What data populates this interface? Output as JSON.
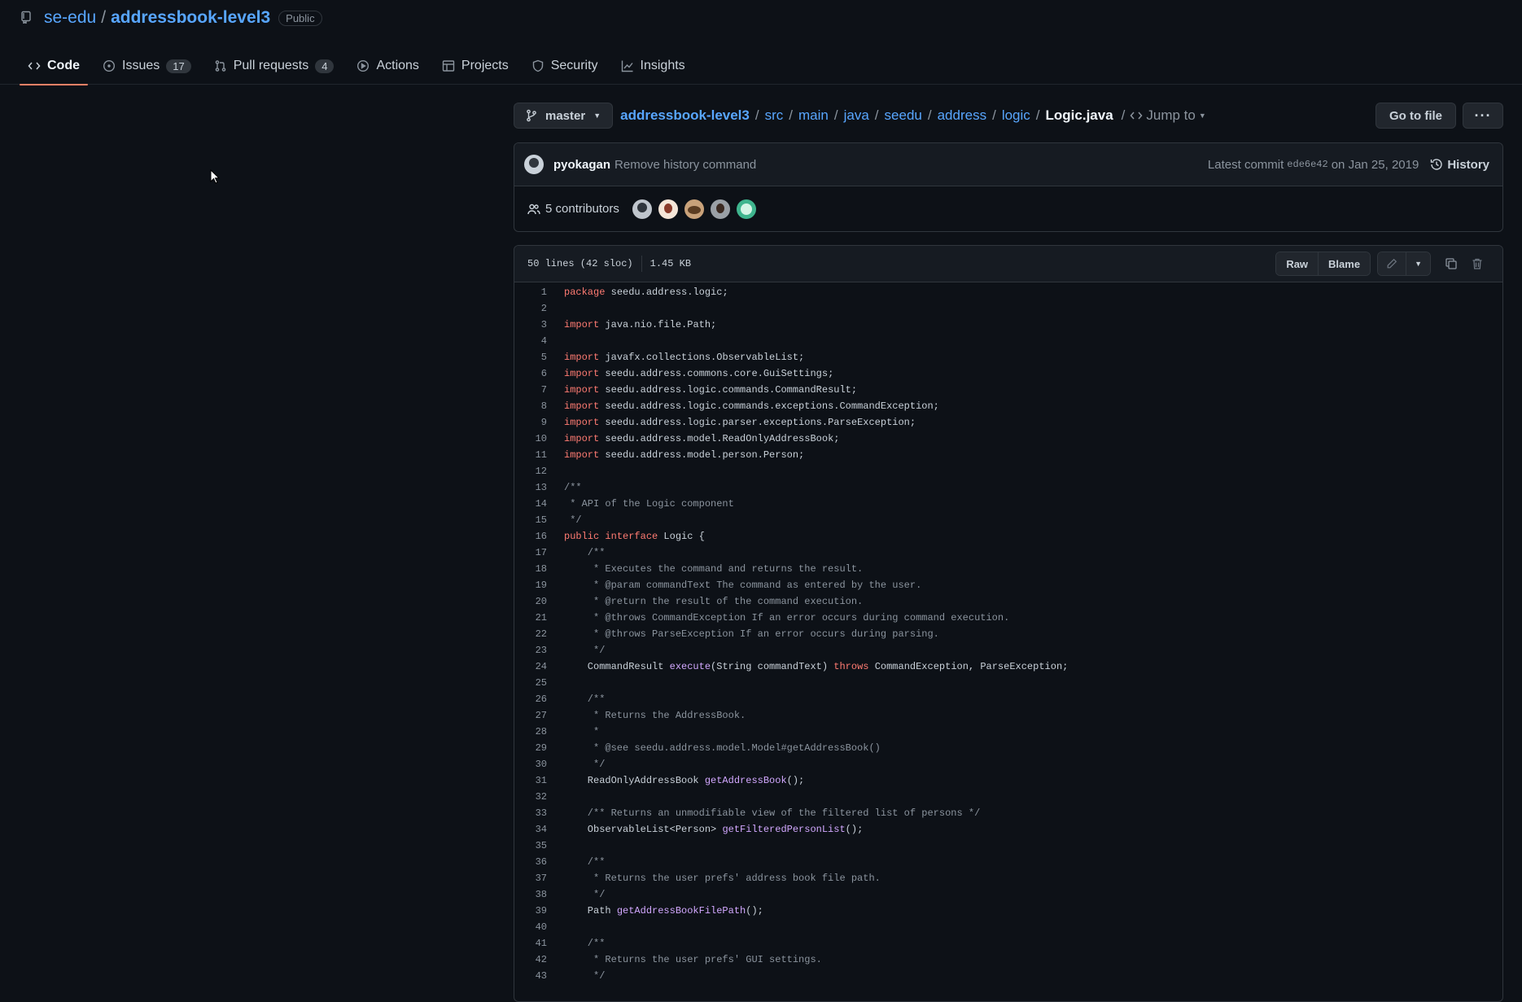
{
  "repo": {
    "owner": "se-edu",
    "separator": "/",
    "name": "addressbook-level3",
    "visibility": "Public"
  },
  "tabs": [
    {
      "label": "Code",
      "icon": "code-icon",
      "active": true
    },
    {
      "label": "Issues",
      "icon": "issue-icon",
      "count": "17"
    },
    {
      "label": "Pull requests",
      "icon": "pull-request-icon",
      "count": "4"
    },
    {
      "label": "Actions",
      "icon": "play-icon"
    },
    {
      "label": "Projects",
      "icon": "table-icon"
    },
    {
      "label": "Security",
      "icon": "shield-icon"
    },
    {
      "label": "Insights",
      "icon": "graph-icon"
    }
  ],
  "branch": {
    "name": "master"
  },
  "breadcrumbs": [
    "addressbook-level3",
    "src",
    "main",
    "java",
    "seedu",
    "address",
    "logic"
  ],
  "breadcrumb_sep": "/",
  "file_name": "Logic.java",
  "jump_to": "Jump to",
  "go_to_file": "Go to file",
  "more_label": "···",
  "commit": {
    "author": "pyokagan",
    "message": "Remove history command",
    "latest_label": "Latest commit",
    "sha": "ede6e42",
    "date": "on Jan 25, 2019",
    "history_label": "History"
  },
  "contributors": {
    "label": "5 contributors"
  },
  "file_stats": {
    "lines": "50 lines (42 sloc)",
    "size": "1.45 KB"
  },
  "file_buttons": {
    "raw": "Raw",
    "blame": "Blame"
  },
  "code_lines": [
    {
      "n": "1",
      "parts": [
        {
          "t": "kw",
          "s": "package"
        },
        {
          "t": "",
          "s": " seedu.address.logic;"
        }
      ]
    },
    {
      "n": "2",
      "parts": []
    },
    {
      "n": "3",
      "parts": [
        {
          "t": "kw",
          "s": "import"
        },
        {
          "t": "",
          "s": " java.nio.file.Path;"
        }
      ]
    },
    {
      "n": "4",
      "parts": []
    },
    {
      "n": "5",
      "parts": [
        {
          "t": "kw",
          "s": "import"
        },
        {
          "t": "",
          "s": " javafx.collections.ObservableList;"
        }
      ]
    },
    {
      "n": "6",
      "parts": [
        {
          "t": "kw",
          "s": "import"
        },
        {
          "t": "",
          "s": " seedu.address.commons.core.GuiSettings;"
        }
      ]
    },
    {
      "n": "7",
      "parts": [
        {
          "t": "kw",
          "s": "import"
        },
        {
          "t": "",
          "s": " seedu.address.logic.commands.CommandResult;"
        }
      ]
    },
    {
      "n": "8",
      "parts": [
        {
          "t": "kw",
          "s": "import"
        },
        {
          "t": "",
          "s": " seedu.address.logic.commands.exceptions.CommandException;"
        }
      ]
    },
    {
      "n": "9",
      "parts": [
        {
          "t": "kw",
          "s": "import"
        },
        {
          "t": "",
          "s": " seedu.address.logic.parser.exceptions.ParseException;"
        }
      ]
    },
    {
      "n": "10",
      "parts": [
        {
          "t": "kw",
          "s": "import"
        },
        {
          "t": "",
          "s": " seedu.address.model.ReadOnlyAddressBook;"
        }
      ]
    },
    {
      "n": "11",
      "parts": [
        {
          "t": "kw",
          "s": "import"
        },
        {
          "t": "",
          "s": " seedu.address.model.person.Person;"
        }
      ]
    },
    {
      "n": "12",
      "parts": []
    },
    {
      "n": "13",
      "parts": [
        {
          "t": "cm",
          "s": "/**"
        }
      ]
    },
    {
      "n": "14",
      "parts": [
        {
          "t": "cm",
          "s": " * API of the Logic component"
        }
      ]
    },
    {
      "n": "15",
      "parts": [
        {
          "t": "cm",
          "s": " */"
        }
      ]
    },
    {
      "n": "16",
      "parts": [
        {
          "t": "kw",
          "s": "public"
        },
        {
          "t": "",
          "s": " "
        },
        {
          "t": "kw",
          "s": "interface"
        },
        {
          "t": "",
          "s": " Logic {"
        }
      ]
    },
    {
      "n": "17",
      "parts": [
        {
          "t": "cm",
          "s": "    /**"
        }
      ]
    },
    {
      "n": "18",
      "parts": [
        {
          "t": "cm",
          "s": "     * Executes the command and returns the result."
        }
      ]
    },
    {
      "n": "19",
      "parts": [
        {
          "t": "cm",
          "s": "     * @param commandText The command as entered by the user."
        }
      ]
    },
    {
      "n": "20",
      "parts": [
        {
          "t": "cm",
          "s": "     * @return the result of the command execution."
        }
      ]
    },
    {
      "n": "21",
      "parts": [
        {
          "t": "cm",
          "s": "     * @throws CommandException If an error occurs during command execution."
        }
      ]
    },
    {
      "n": "22",
      "parts": [
        {
          "t": "cm",
          "s": "     * @throws ParseException If an error occurs during parsing."
        }
      ]
    },
    {
      "n": "23",
      "parts": [
        {
          "t": "cm",
          "s": "     */"
        }
      ]
    },
    {
      "n": "24",
      "parts": [
        {
          "t": "",
          "s": "    CommandResult "
        },
        {
          "t": "fn",
          "s": "execute"
        },
        {
          "t": "",
          "s": "(String commandText) "
        },
        {
          "t": "kw",
          "s": "throws"
        },
        {
          "t": "",
          "s": " CommandException, ParseException;"
        }
      ]
    },
    {
      "n": "25",
      "parts": []
    },
    {
      "n": "26",
      "parts": [
        {
          "t": "cm",
          "s": "    /**"
        }
      ]
    },
    {
      "n": "27",
      "parts": [
        {
          "t": "cm",
          "s": "     * Returns the AddressBook."
        }
      ]
    },
    {
      "n": "28",
      "parts": [
        {
          "t": "cm",
          "s": "     *"
        }
      ]
    },
    {
      "n": "29",
      "parts": [
        {
          "t": "cm",
          "s": "     * @see seedu.address.model.Model#getAddressBook()"
        }
      ]
    },
    {
      "n": "30",
      "parts": [
        {
          "t": "cm",
          "s": "     */"
        }
      ]
    },
    {
      "n": "31",
      "parts": [
        {
          "t": "",
          "s": "    ReadOnlyAddressBook "
        },
        {
          "t": "fn",
          "s": "getAddressBook"
        },
        {
          "t": "",
          "s": "();"
        }
      ]
    },
    {
      "n": "32",
      "parts": []
    },
    {
      "n": "33",
      "parts": [
        {
          "t": "cm",
          "s": "    /** Returns an unmodifiable view of the filtered list of persons */"
        }
      ]
    },
    {
      "n": "34",
      "parts": [
        {
          "t": "",
          "s": "    ObservableList<Person> "
        },
        {
          "t": "fn",
          "s": "getFilteredPersonList"
        },
        {
          "t": "",
          "s": "();"
        }
      ]
    },
    {
      "n": "35",
      "parts": []
    },
    {
      "n": "36",
      "parts": [
        {
          "t": "cm",
          "s": "    /**"
        }
      ]
    },
    {
      "n": "37",
      "parts": [
        {
          "t": "cm",
          "s": "     * Returns the user prefs' address book file path."
        }
      ]
    },
    {
      "n": "38",
      "parts": [
        {
          "t": "cm",
          "s": "     */"
        }
      ]
    },
    {
      "n": "39",
      "parts": [
        {
          "t": "",
          "s": "    Path "
        },
        {
          "t": "fn",
          "s": "getAddressBookFilePath"
        },
        {
          "t": "",
          "s": "();"
        }
      ]
    },
    {
      "n": "40",
      "parts": []
    },
    {
      "n": "41",
      "parts": [
        {
          "t": "cm",
          "s": "    /**"
        }
      ]
    },
    {
      "n": "42",
      "parts": [
        {
          "t": "cm",
          "s": "     * Returns the user prefs' GUI settings."
        }
      ]
    },
    {
      "n": "43",
      "parts": [
        {
          "t": "cm",
          "s": "     */"
        }
      ]
    }
  ],
  "colors": {
    "background": "#0d1117",
    "link": "#58a6ff",
    "keyword": "#ff7b72",
    "comment": "#8b949e",
    "function": "#d2a8ff",
    "active_tab_underline": "#f78166"
  }
}
